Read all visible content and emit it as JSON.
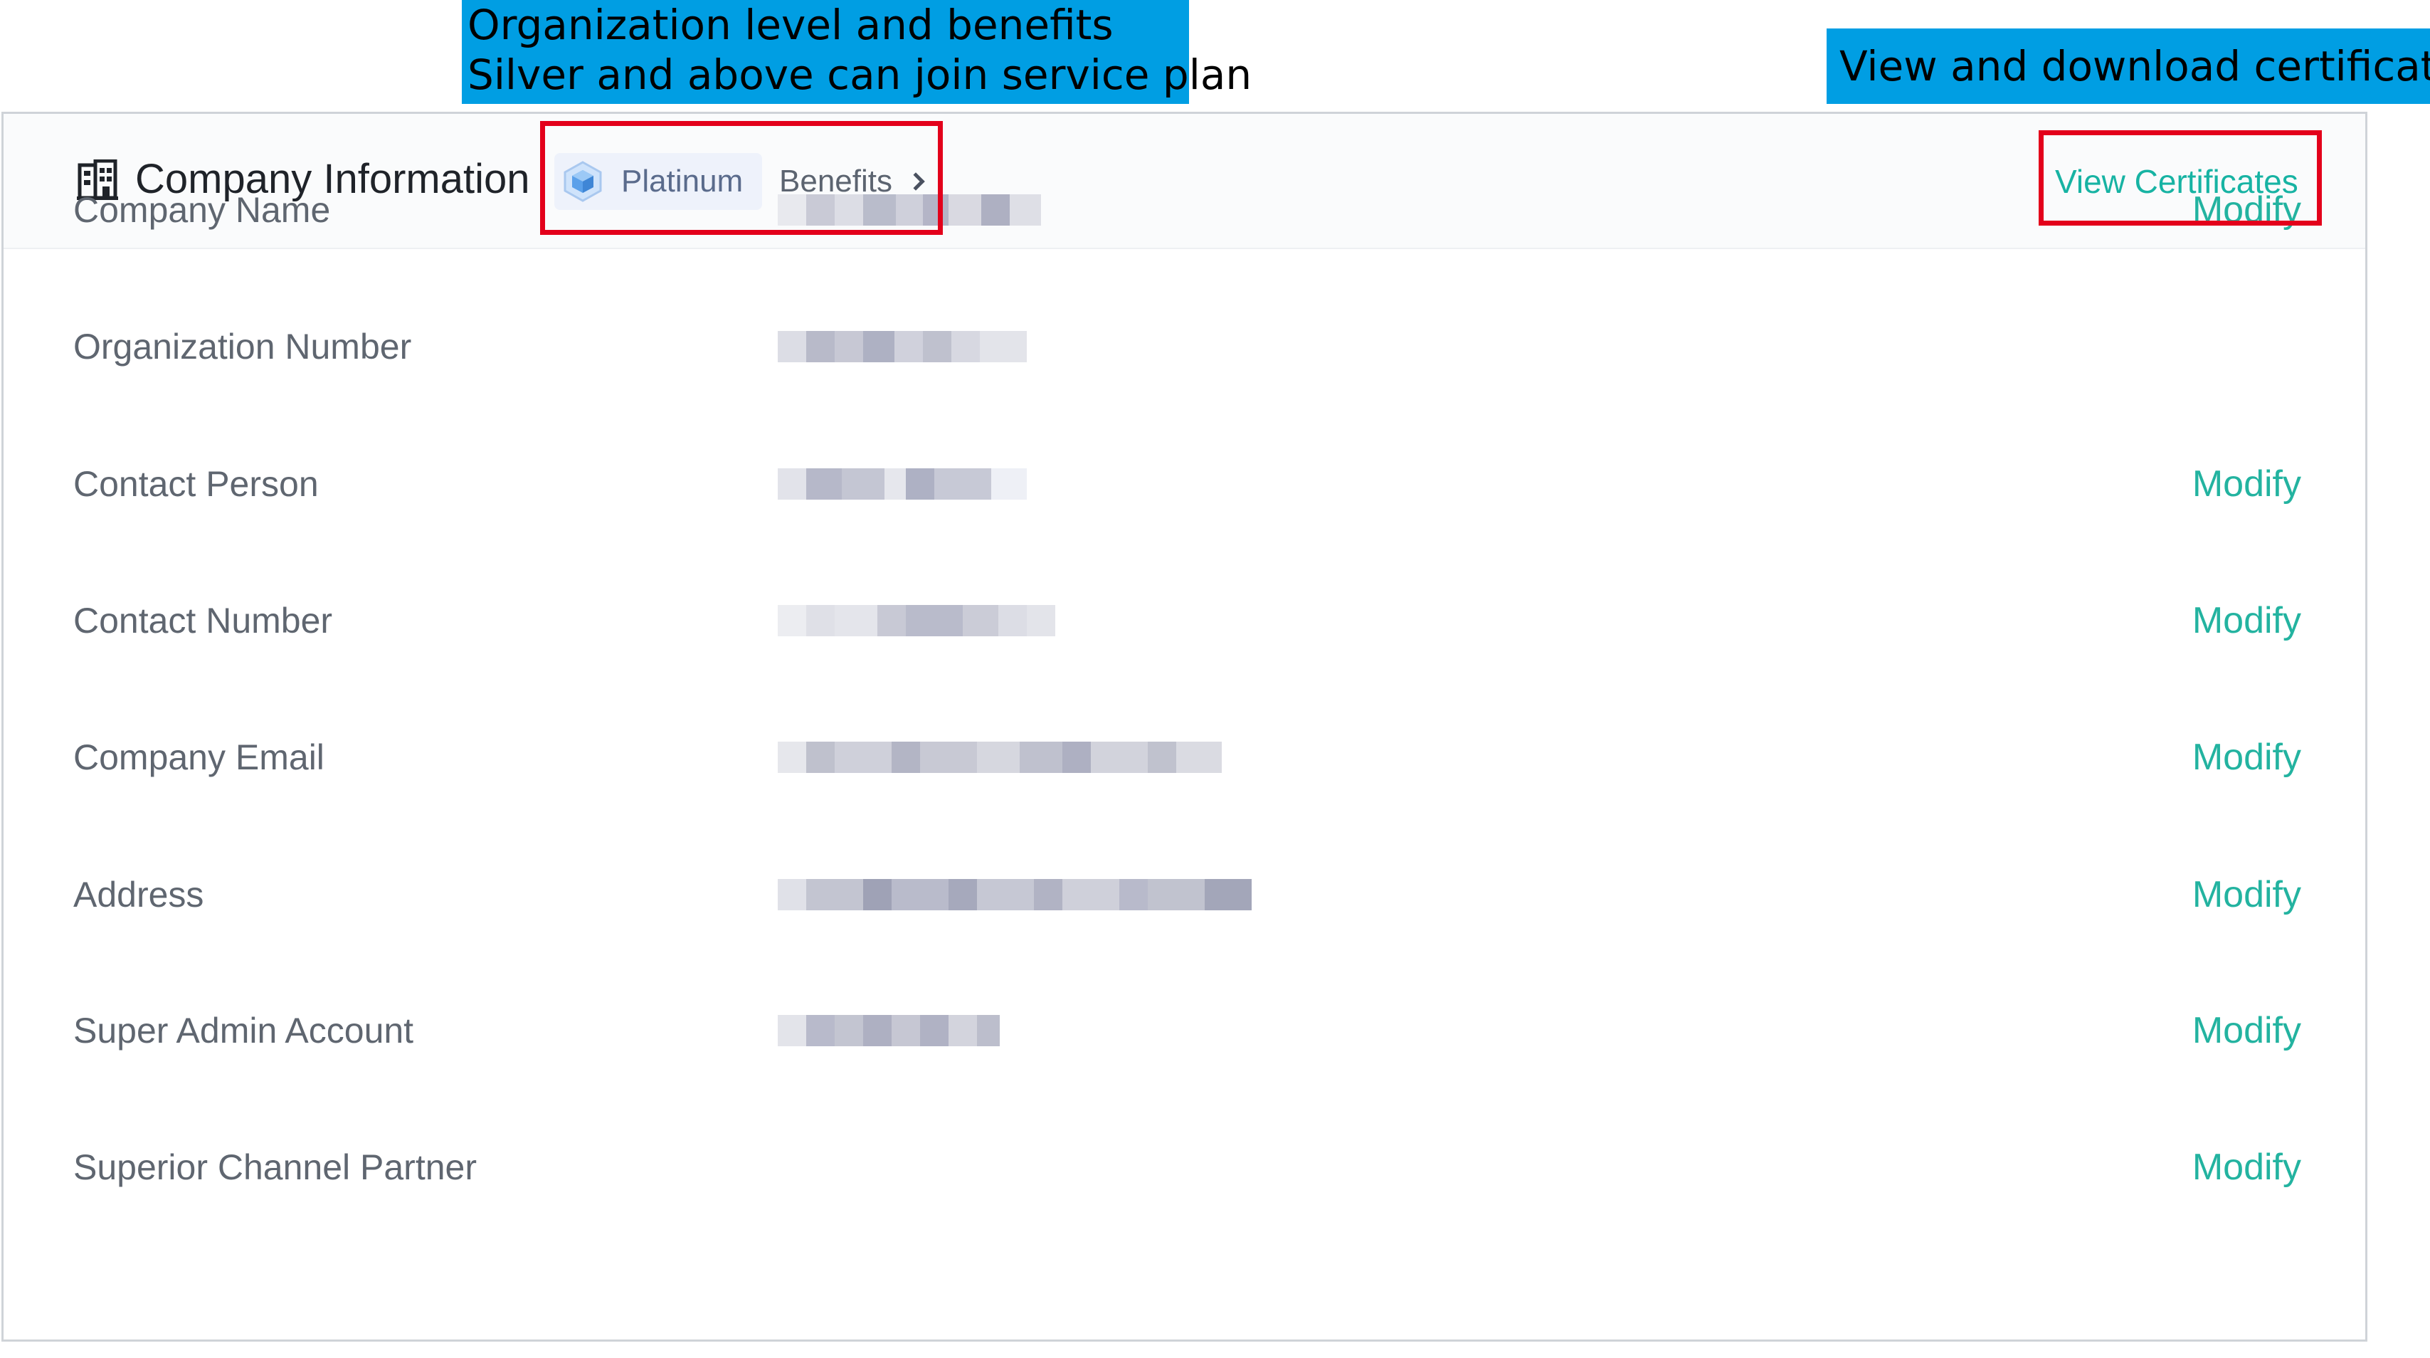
{
  "annotations": {
    "level_callout": [
      "Organization level and benefits",
      "Silver and above can join service plan"
    ],
    "certificate_callout": "View and download certificate"
  },
  "header": {
    "title": "Company Information",
    "level_label": "Platinum",
    "benefits_label": "Benefits",
    "view_certificates_label": "View Certificates"
  },
  "rows": [
    {
      "label": "Company Name",
      "modify": "Modify"
    },
    {
      "label": "Organization Number",
      "modify": ""
    },
    {
      "label": "Contact Person",
      "modify": "Modify"
    },
    {
      "label": "Contact Number",
      "modify": "Modify"
    },
    {
      "label": "Company Email",
      "modify": "Modify"
    },
    {
      "label": "Address",
      "modify": "Modify"
    },
    {
      "label": "Super Admin Account",
      "modify": "Modify"
    },
    {
      "label": "Superior Channel Partner",
      "modify": "Modify"
    }
  ],
  "colors": {
    "accent": "#23b3a0",
    "callout_bg": "#009ee3",
    "highlight_border": "#e3001b"
  },
  "icons": {
    "header": "building-icon",
    "level": "platinum-gem-icon",
    "benefits": "chevron-right-icon"
  }
}
